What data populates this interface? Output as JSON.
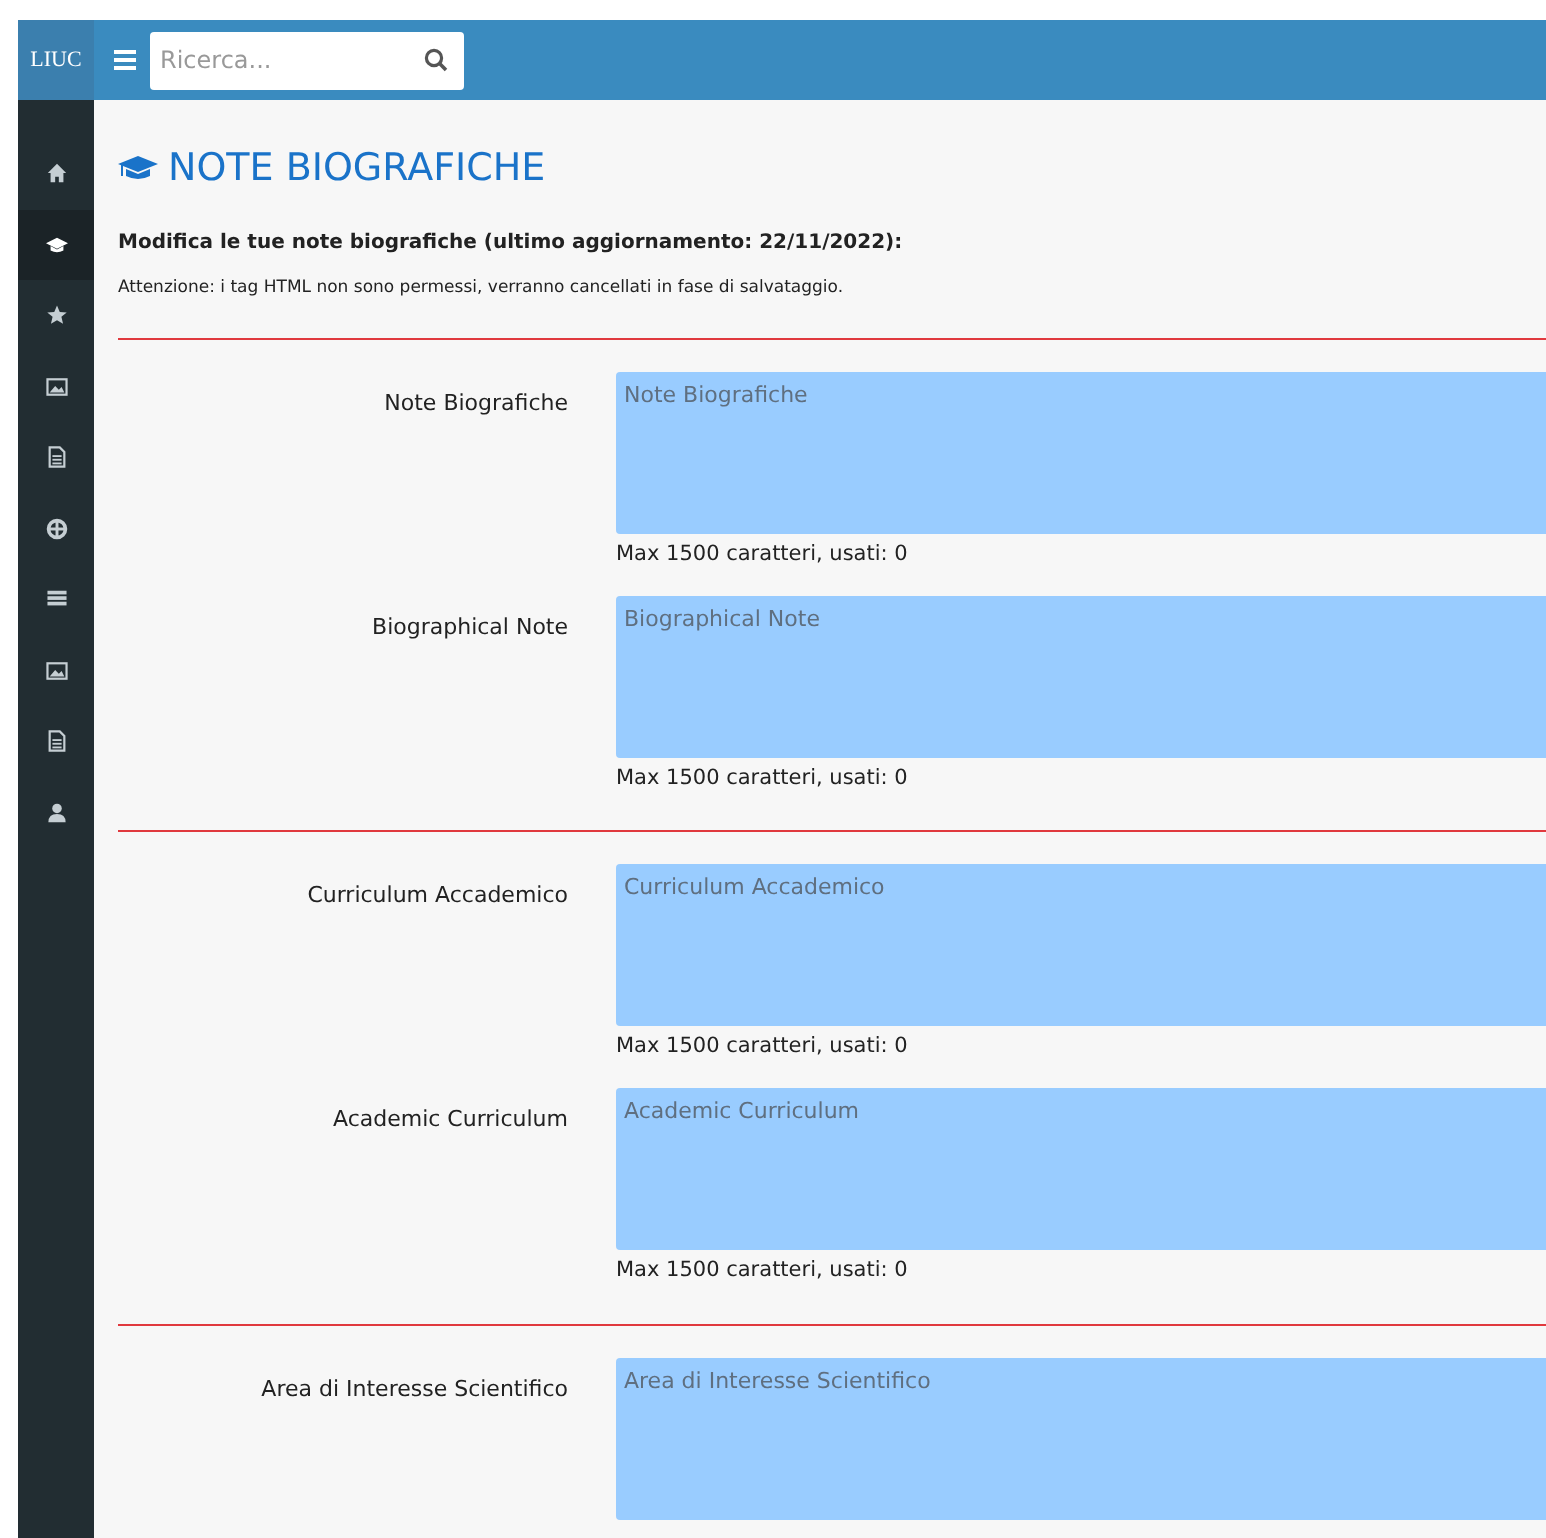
{
  "header": {
    "logo": "LIUC",
    "search": {
      "placeholder": "Ricerca..."
    }
  },
  "sidebar": {
    "items": [
      {
        "kind": "home",
        "selected": false
      },
      {
        "kind": "cap",
        "selected": true
      },
      {
        "kind": "star",
        "selected": false
      },
      {
        "kind": "image",
        "selected": false
      },
      {
        "kind": "file",
        "selected": false
      },
      {
        "kind": "globe",
        "selected": false
      },
      {
        "kind": "list",
        "selected": false
      },
      {
        "kind": "image",
        "selected": false
      },
      {
        "kind": "file",
        "selected": false
      },
      {
        "kind": "user",
        "selected": false
      }
    ]
  },
  "page": {
    "title": "NOTE BIOGRAFICHE",
    "intro": "Modifica le tue note biografiche (ultimo aggiornamento: 22/11/2022):",
    "warning": "Attenzione: i tag HTML non sono permessi, verranno cancellati in fase di salvataggio."
  },
  "sections": [
    {
      "fields": [
        {
          "label": "Note Biografiche",
          "placeholder": "Note Biografiche",
          "counter": "Max 1500 caratteri, usati: 0"
        },
        {
          "label": "Biographical Note",
          "placeholder": "Biographical Note",
          "counter": "Max 1500 caratteri, usati: 0"
        }
      ]
    },
    {
      "fields": [
        {
          "label": "Curriculum Accademico",
          "placeholder": "Curriculum Accademico",
          "counter": "Max 1500 caratteri, usati: 0"
        },
        {
          "label": "Academic Curriculum",
          "placeholder": "Academic Curriculum",
          "counter": "Max 1500 caratteri, usati: 0"
        }
      ]
    },
    {
      "fields": [
        {
          "label": "Area di Interesse Scientifico",
          "placeholder": "Area di Interesse Scientifico"
        }
      ]
    }
  ]
}
